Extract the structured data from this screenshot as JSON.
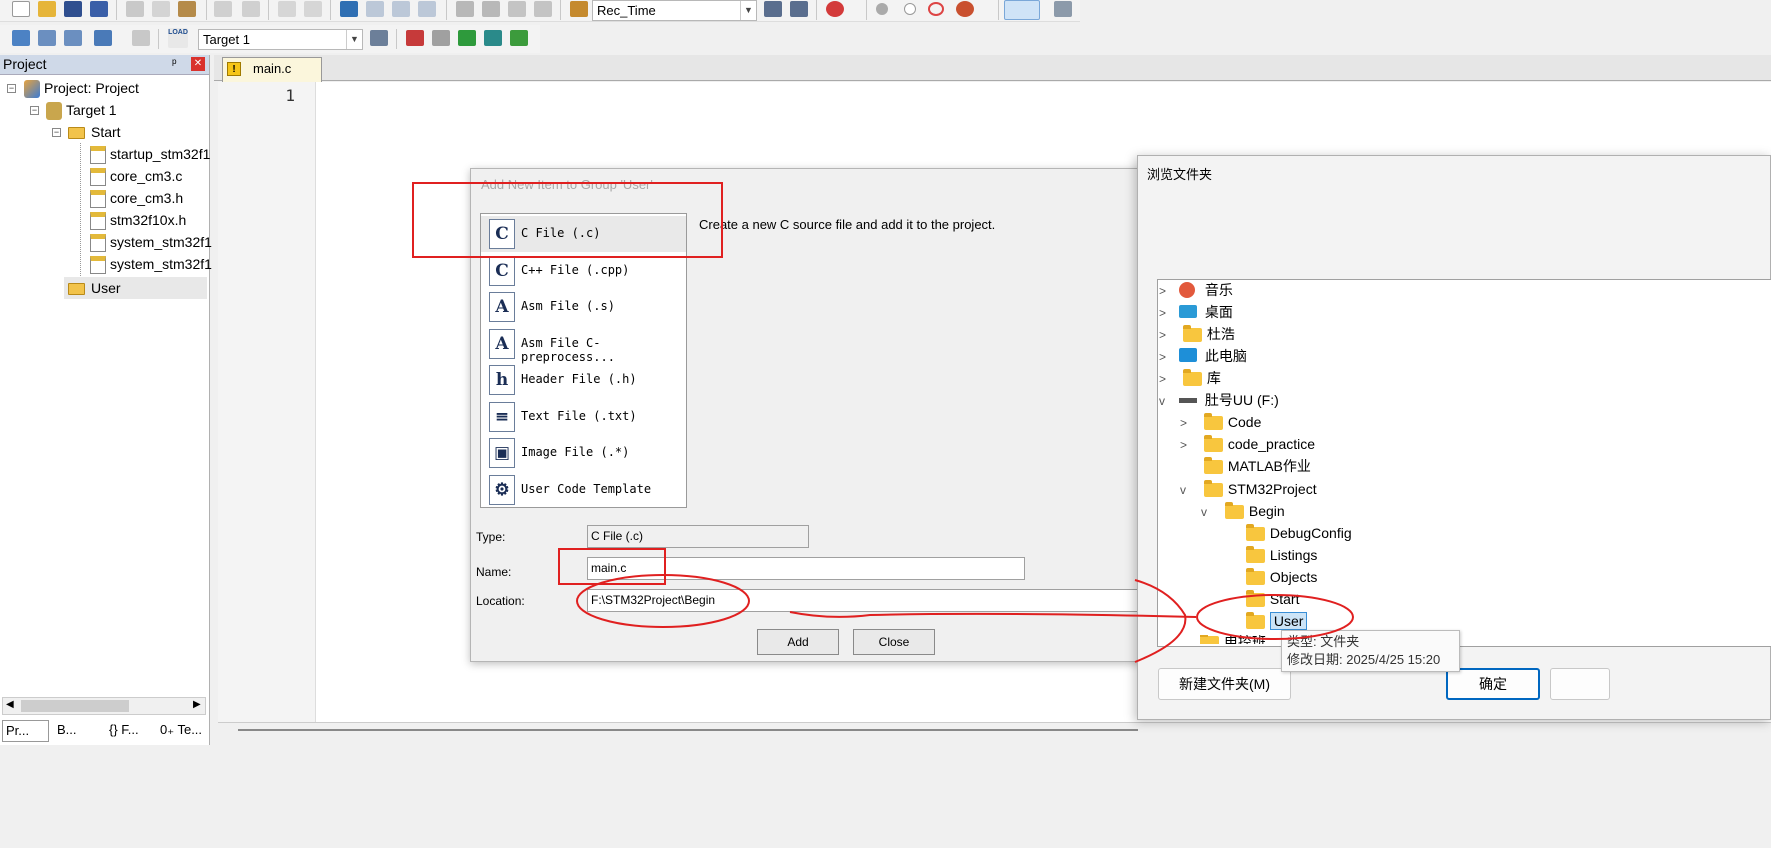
{
  "toolbar1": {
    "combo_value": "Rec_Time"
  },
  "toolbar2": {
    "target_value": "Target 1",
    "load_label": "LOAD"
  },
  "project_panel": {
    "title": "Project",
    "pin": "ᵖ",
    "close": "✕",
    "tree": {
      "root": "Project: Project",
      "target": "Target 1",
      "group_start": "Start",
      "files": [
        "startup_stm32f1",
        "core_cm3.c",
        "core_cm3.h",
        "stm32f10x.h",
        "system_stm32f1",
        "system_stm32f1"
      ],
      "group_user": "User"
    },
    "bottom_tabs": [
      "Pr...",
      "B...",
      "{} F...",
      "0₊ Te..."
    ]
  },
  "editor": {
    "tab_label": "main.c",
    "line_number": "1"
  },
  "add_dialog": {
    "title": "Add New Item to Group 'User'",
    "description": "Create a new C source file and add it to the project.",
    "items": [
      {
        "icon": "C",
        "label": "C File (.c)"
      },
      {
        "icon": "C",
        "label": "C++ File (.cpp)"
      },
      {
        "icon": "A",
        "label": "Asm File (.s)"
      },
      {
        "icon": "A",
        "label": "Asm File C-preprocess..."
      },
      {
        "icon": "h",
        "label": "Header File (.h)"
      },
      {
        "icon": "≡",
        "label": "Text File (.txt)"
      },
      {
        "icon": "▣",
        "label": "Image File (.*)"
      },
      {
        "icon": "⚙",
        "label": "User Code Template"
      }
    ],
    "type_label": "Type:",
    "type_value": "C File (.c)",
    "name_label": "Name:",
    "name_value": "main.c",
    "location_label": "Location:",
    "location_value": "F:\\STM32Project\\Begin",
    "add_button": "Add",
    "close_button": "Close"
  },
  "browse_dialog": {
    "title": "浏览文件夹",
    "tree": [
      {
        "label": "音乐",
        "level": 0,
        "chevron": ">"
      },
      {
        "label": "桌面",
        "level": 0,
        "chevron": ">"
      },
      {
        "label": "杜浩",
        "level": 0,
        "chevron": ">"
      },
      {
        "label": "此电脑",
        "level": 0,
        "chevron": ">"
      },
      {
        "label": "库",
        "level": 0,
        "chevron": ">"
      },
      {
        "label": "肚号UU (F:)",
        "level": 0,
        "chevron": "v"
      },
      {
        "label": "Code",
        "level": 1,
        "chevron": ">"
      },
      {
        "label": "code_practice",
        "level": 1,
        "chevron": ">"
      },
      {
        "label": "MATLAB作业",
        "level": 1,
        "chevron": ""
      },
      {
        "label": "STM32Project",
        "level": 1,
        "chevron": "v"
      },
      {
        "label": "Begin",
        "level": 2,
        "chevron": "v"
      },
      {
        "label": "DebugConfig",
        "level": 3,
        "chevron": ""
      },
      {
        "label": "Listings",
        "level": 3,
        "chevron": ""
      },
      {
        "label": "Objects",
        "level": 3,
        "chevron": ""
      },
      {
        "label": "Start",
        "level": 3,
        "chevron": ""
      },
      {
        "label": "User",
        "level": 3,
        "chevron": ""
      }
    ],
    "partial_row": "电控班",
    "tooltip_type": "类型: 文件夹",
    "tooltip_modified": "修改日期: 2025/4/25 15:20",
    "new_folder_button": "新建文件夹(M)",
    "ok_button": "确定"
  },
  "colors": {
    "annotation_red": "#e02020",
    "panel_title_bg": "#cfd9e8",
    "folder_yellow": "#f8c63e",
    "accent_blue": "#0067c0"
  }
}
